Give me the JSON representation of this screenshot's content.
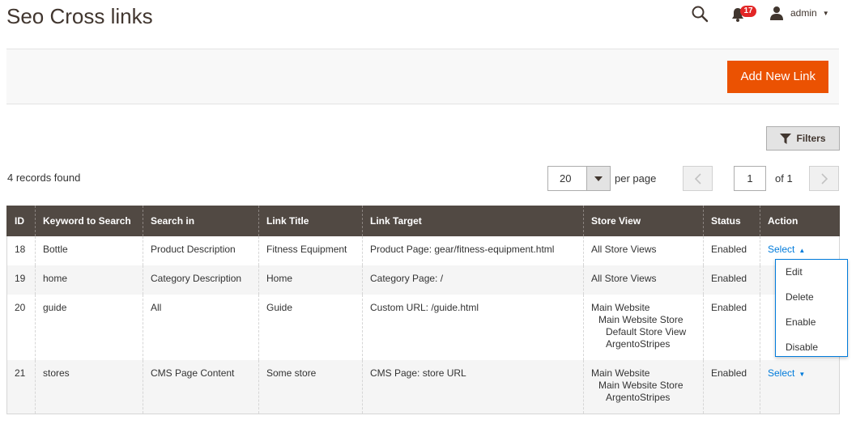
{
  "header": {
    "title": "Seo Cross links",
    "notifications_count": "17",
    "user_name": "admin"
  },
  "actions": {
    "add_new_label": "Add New Link",
    "filters_label": "Filters"
  },
  "grid_toolbar": {
    "records_found": "4 records found",
    "per_page_value": "20",
    "per_page_label": "per page",
    "current_page": "1",
    "total_pages_label": "of 1"
  },
  "columns": [
    "ID",
    "Keyword to Search",
    "Search in",
    "Link Title",
    "Link Target",
    "Store View",
    "Status",
    "Action"
  ],
  "rows": [
    {
      "id": "18",
      "keyword": "Bottle",
      "search_in": "Product Description",
      "link_title": "Fitness Equipment",
      "link_target": "Product Page: gear/fitness-equipment.html",
      "store_view": [
        "All Store Views"
      ],
      "status": "Enabled",
      "action": "Select"
    },
    {
      "id": "19",
      "keyword": "home",
      "search_in": "Category Description",
      "link_title": "Home",
      "link_target": "Category Page: /",
      "store_view": [
        "All Store Views"
      ],
      "status": "Enabled",
      "action": ""
    },
    {
      "id": "20",
      "keyword": "guide",
      "search_in": "All",
      "link_title": "Guide",
      "link_target": "Custom URL: /guide.html",
      "store_view": [
        "Main Website",
        "Main Website Store",
        "Default Store View",
        "ArgentoStripes"
      ],
      "status": "Enabled",
      "action": ""
    },
    {
      "id": "21",
      "keyword": "stores",
      "search_in": "CMS Page Content",
      "link_title": "Some store",
      "link_target": "CMS Page: store URL",
      "store_view": [
        "Main Website",
        "Main Website Store",
        "ArgentoStripes"
      ],
      "status": "Enabled",
      "action": "Select"
    }
  ],
  "action_menu": [
    "Edit",
    "Delete",
    "Enable",
    "Disable"
  ],
  "colors": {
    "accent": "#eb5202",
    "header_bg": "#514943",
    "link": "#007bdb",
    "badge": "#e22626"
  }
}
